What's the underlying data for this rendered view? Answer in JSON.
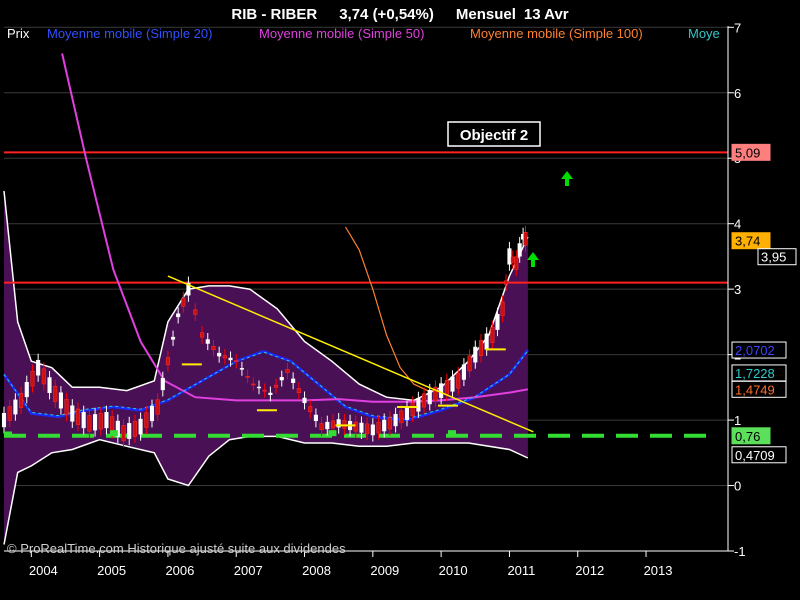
{
  "header": {
    "symbol": "RIB - RIBER",
    "price_change": "3,74 (+0,54%)",
    "period": "Mensuel",
    "date": "13 Avr"
  },
  "legend": {
    "price": "Prix",
    "ma20": "Moyenne mobile (Simple 20)",
    "ma50": "Moyenne mobile (Simple 50)",
    "ma100": "Moyenne mobile (Simple 100)",
    "truncated": "Moye"
  },
  "annotations": {
    "objective": "Objectif 2",
    "credit": "© ProRealTime.com Historique ajusté suite aux dividendes"
  },
  "axis_badges": [
    {
      "label": "5,09",
      "value": 5.09,
      "bg": "#ff7f7f",
      "fg": "#000000"
    },
    {
      "label": "3,74",
      "value": 3.74,
      "bg": "#ffb000",
      "fg": "#000000"
    },
    {
      "label": "3,95",
      "value": 3.74,
      "bg": "#000000",
      "fg": "#ffffff",
      "partial": true
    },
    {
      "label": "2,0702",
      "value": 2.07,
      "bg": "#000000",
      "fg": "#4040ff"
    },
    {
      "label": "1,7228",
      "value": 1.72,
      "bg": "#000000",
      "fg": "#30c8c8"
    },
    {
      "label": "1,4749",
      "value": 1.47,
      "bg": "#000000",
      "fg": "#ff7030"
    },
    {
      "label": "0,76",
      "value": 0.76,
      "bg": "#5ce05c",
      "fg": "#000000"
    },
    {
      "label": "0,4709",
      "value": 0.47,
      "bg": "#000000",
      "fg": "#ffffff"
    },
    {
      "label": "0",
      "value": 0.0,
      "bg": "#000000",
      "fg": "#ffffff"
    }
  ],
  "colors": {
    "background": "#000000",
    "band_fill": "#4a1055",
    "ma20": "#1a2aff",
    "ma50": "#e040e0",
    "ma100": "#ff8030",
    "ma_extra": "#30c8c8",
    "resistance": "#ff2020",
    "support": "#33dd33",
    "trendline": "#ffee00",
    "candle_up": "#ffffff",
    "candle_down": "#ff0000",
    "arrow": "#00dd00"
  },
  "chart_data": {
    "type": "line",
    "title": "RIB - RIBER 3,74 (+0,54%) Mensuel 13 Avr",
    "x_ticks": [
      "2004",
      "2005",
      "2006",
      "2007",
      "2008",
      "2009",
      "2010",
      "2011",
      "2012",
      "2013"
    ],
    "y_ticks": [
      -1,
      0,
      1,
      2,
      3,
      4,
      5,
      6,
      7
    ],
    "ylim": [
      -1,
      7.1
    ],
    "xlim": [
      2003.6,
      2014.2
    ],
    "grid": true,
    "legend_position": "top",
    "horizontal_lines": [
      {
        "name": "resistance-objectif-2",
        "y": 5.09,
        "style": "solid"
      },
      {
        "name": "resistance",
        "y": 3.1,
        "style": "solid"
      },
      {
        "name": "support",
        "y": 0.76,
        "style": "dashed"
      }
    ],
    "trendline": {
      "x": [
        2006.0,
        2011.35
      ],
      "y": [
        3.2,
        0.82
      ]
    },
    "series": [
      {
        "name": "Prix",
        "x": [
          2003.6,
          2003.85,
          2004.1,
          2004.35,
          2004.6,
          2004.85,
          2005.1,
          2005.35,
          2005.6,
          2005.85,
          2006.0,
          2006.15,
          2006.3,
          2006.5,
          2006.75,
          2007.0,
          2007.25,
          2007.5,
          2007.75,
          2008.0,
          2008.25,
          2008.5,
          2008.75,
          2009.0,
          2009.25,
          2009.5,
          2009.75,
          2010.0,
          2010.25,
          2010.5,
          2010.75,
          2010.9,
          2011.0,
          2011.1,
          2011.2,
          2011.27
        ],
        "y": [
          1.0,
          1.3,
          1.8,
          1.4,
          1.1,
          0.95,
          1.0,
          0.8,
          0.9,
          1.2,
          1.9,
          2.6,
          3.0,
          2.3,
          2.0,
          1.9,
          1.55,
          1.4,
          1.75,
          1.3,
          0.9,
          0.95,
          0.9,
          0.85,
          0.95,
          1.1,
          1.3,
          1.45,
          1.6,
          2.0,
          2.3,
          2.7,
          3.5,
          3.4,
          3.8,
          3.74
        ]
      },
      {
        "name": "Moyenne mobile (Simple 20)",
        "x": [
          2003.6,
          2004.0,
          2004.4,
          2004.8,
          2005.2,
          2005.6,
          2006.0,
          2006.5,
          2007.0,
          2007.4,
          2007.8,
          2008.2,
          2008.6,
          2009.0,
          2009.5,
          2010.0,
          2010.5,
          2011.0,
          2011.27
        ],
        "y": [
          1.7,
          1.1,
          1.05,
          1.15,
          1.2,
          1.15,
          1.3,
          1.6,
          1.9,
          2.05,
          1.9,
          1.55,
          1.2,
          1.05,
          1.0,
          1.15,
          1.35,
          1.7,
          2.07
        ]
      },
      {
        "name": "Moyenne mobile (Simple 50)",
        "x": [
          2004.45,
          2004.8,
          2005.2,
          2005.6,
          2005.95,
          2006.4,
          2007.0,
          2007.5,
          2008.0,
          2008.5,
          2009.0,
          2009.5,
          2010.0,
          2010.5,
          2011.0,
          2011.27
        ],
        "y": [
          6.6,
          5.0,
          3.3,
          2.2,
          1.6,
          1.35,
          1.3,
          1.3,
          1.3,
          1.32,
          1.28,
          1.28,
          1.3,
          1.35,
          1.42,
          1.47
        ]
      },
      {
        "name": "Moyenne mobile (Simple 100)",
        "x": [
          2008.6,
          2008.8,
          2009.0,
          2009.2,
          2009.4,
          2009.6,
          2009.8,
          2010.0
        ],
        "y": [
          3.95,
          3.6,
          3.0,
          2.3,
          1.8,
          1.55,
          1.45,
          1.45
        ]
      }
    ],
    "bands": {
      "upper": {
        "x": [
          2003.6,
          2003.8,
          2004.0,
          2004.3,
          2004.6,
          2005.0,
          2005.4,
          2005.8,
          2006.0,
          2006.3,
          2006.6,
          2006.9,
          2007.2,
          2007.6,
          2008.0,
          2008.4,
          2008.8,
          2009.2,
          2009.6,
          2010.0,
          2010.4,
          2010.7,
          2011.0,
          2011.27
        ],
        "y": [
          4.5,
          2.5,
          1.9,
          1.8,
          1.5,
          1.5,
          1.45,
          1.6,
          2.5,
          3.0,
          3.05,
          3.05,
          3.0,
          2.7,
          2.2,
          1.9,
          1.55,
          1.35,
          1.3,
          1.5,
          1.9,
          2.3,
          3.2,
          3.8
        ]
      },
      "lower": {
        "x": [
          2003.6,
          2003.8,
          2004.0,
          2004.3,
          2004.6,
          2005.0,
          2005.4,
          2005.8,
          2006.0,
          2006.3,
          2006.6,
          2006.9,
          2007.2,
          2007.6,
          2008.0,
          2008.4,
          2008.8,
          2009.2,
          2009.6,
          2010.0,
          2010.4,
          2010.7,
          2011.0,
          2011.27
        ],
        "y": [
          -0.9,
          0.2,
          0.3,
          0.5,
          0.55,
          0.7,
          0.6,
          0.5,
          0.1,
          0.0,
          0.45,
          0.7,
          0.75,
          0.75,
          0.65,
          0.65,
          0.6,
          0.6,
          0.65,
          0.65,
          0.65,
          0.6,
          0.55,
          0.42
        ]
      }
    }
  }
}
